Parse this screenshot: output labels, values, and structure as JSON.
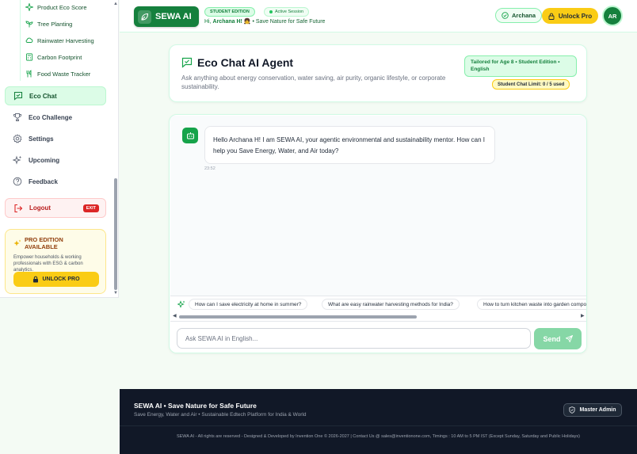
{
  "sidebar": {
    "sub_items": [
      {
        "label": "Product Eco Score",
        "icon": "sparkle-icon"
      },
      {
        "label": "Tree Planting",
        "icon": "sprout-icon"
      },
      {
        "label": "Rainwater Harvesting",
        "icon": "cloud-icon"
      },
      {
        "label": "Carbon Footprint",
        "icon": "calculator-icon"
      },
      {
        "label": "Food Waste Tracker",
        "icon": "utensils-icon"
      }
    ],
    "nav_items": [
      {
        "label": "Eco Chat",
        "icon": "chat-icon",
        "active": true
      },
      {
        "label": "Eco Challenge",
        "icon": "trophy-icon",
        "active": false
      },
      {
        "label": "Settings",
        "icon": "gear-icon",
        "active": false
      },
      {
        "label": "Upcoming",
        "icon": "sparkles-icon",
        "active": false
      },
      {
        "label": "Feedback",
        "icon": "help-icon",
        "active": false
      }
    ],
    "logout_label": "Logout",
    "exit_badge": "EXIT",
    "pro_card": {
      "title": "PRO EDITION AVAILABLE",
      "description": "Empower households & working professionals with ESG & carbon analytics.",
      "button": "UNLOCK PRO"
    }
  },
  "header": {
    "logo_text": "SEWA AI",
    "edition_badge": "STUDENT EDITION",
    "session_badge": "Active Session",
    "greeting_prefix": "Hi,",
    "greeting_name": "Archana H!",
    "greeting_emoji": "👧",
    "greeting_suffix": "• Save Nature for Safe Future",
    "user_pill": "Archana",
    "unlock_button": "Unlock Pro",
    "avatar_initials": "AR"
  },
  "agent": {
    "title": "Eco Chat AI Agent",
    "description": "Ask anything about energy conservation, water saving, air purity, organic lifestyle, or corporate sustainability.",
    "tailored_badge": "Tailored for Age 8 • Student Edition • English",
    "limit_prefix": "Student Chat Limit:",
    "limit_value": "0 / 5 used"
  },
  "chat": {
    "bot_message": "Hello Archana H! I am SEWA AI, your agentic environmental and sustainability mentor. How can I help you Save Energy, Water, and Air today?",
    "message_time": "23:52",
    "suggestions": [
      "How can I save electricity at home in summer?",
      "What are easy rainwater harvesting methods for India?",
      "How to turn kitchen waste into garden compost?"
    ],
    "input_placeholder": "Ask SEWA AI in English...",
    "input_value": "",
    "send_label": "Send"
  },
  "footer": {
    "title": "SEWA AI • Save Nature for Safe Future",
    "subtitle": "Save Energy, Water and Air • Sustainable Edtech Platform for India & World",
    "admin_button": "Master Admin",
    "copyright": "SEWA AI - All rights are reserved - Designed & Developed by Invention One © 2026-2027 | Contact Us @ sales@inventionone.com, Timings : 10 AM to 5 PM IST (Except Sunday, Saturday and Public Holidays)"
  },
  "colors": {
    "brand_green": "#15803d",
    "accent_yellow": "#facc15",
    "logout_red": "#dc2626",
    "footer_bg": "#111827"
  }
}
